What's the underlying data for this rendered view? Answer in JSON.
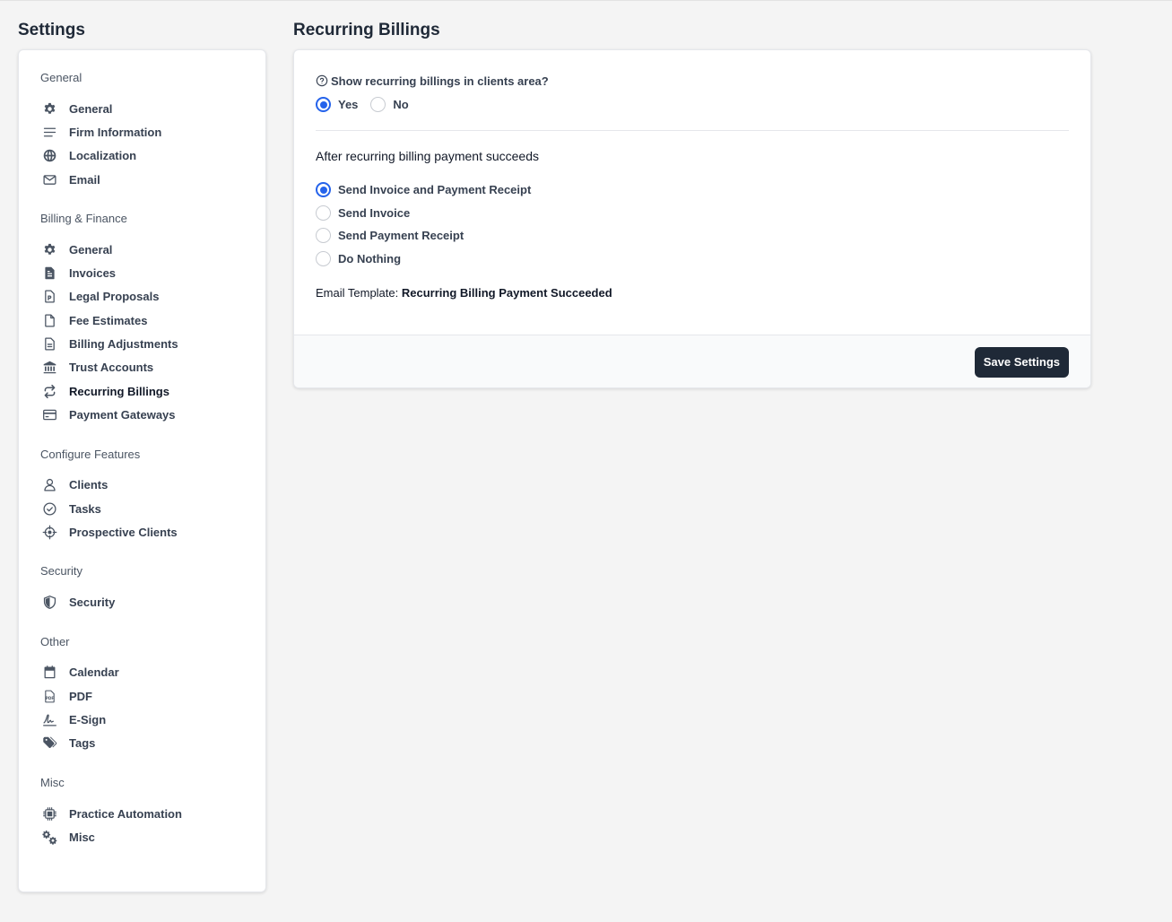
{
  "sidebar": {
    "title": "Settings",
    "sections": [
      {
        "title": "General",
        "items": [
          {
            "label": "General",
            "icon": "gear-icon"
          },
          {
            "label": "Firm Information",
            "icon": "lines-icon"
          },
          {
            "label": "Localization",
            "icon": "globe-icon"
          },
          {
            "label": "Email",
            "icon": "envelope-icon"
          }
        ]
      },
      {
        "title": "Billing & Finance",
        "items": [
          {
            "label": "General",
            "icon": "gear-icon"
          },
          {
            "label": "Invoices",
            "icon": "invoice-icon"
          },
          {
            "label": "Legal Proposals",
            "icon": "proposal-icon"
          },
          {
            "label": "Fee Estimates",
            "icon": "document-icon"
          },
          {
            "label": "Billing Adjustments",
            "icon": "document-lines-icon"
          },
          {
            "label": "Trust Accounts",
            "icon": "bank-icon"
          },
          {
            "label": "Recurring Billings",
            "icon": "repeat-icon",
            "active": true
          },
          {
            "label": "Payment Gateways",
            "icon": "credit-card-icon"
          }
        ]
      },
      {
        "title": "Configure Features",
        "items": [
          {
            "label": "Clients",
            "icon": "user-icon"
          },
          {
            "label": "Tasks",
            "icon": "check-circle-icon"
          },
          {
            "label": "Prospective Clients",
            "icon": "crosshair-icon"
          }
        ]
      },
      {
        "title": "Security",
        "items": [
          {
            "label": "Security",
            "icon": "shield-icon"
          }
        ]
      },
      {
        "title": "Other",
        "items": [
          {
            "label": "Calendar",
            "icon": "calendar-icon"
          },
          {
            "label": "PDF",
            "icon": "pdf-icon"
          },
          {
            "label": "E-Sign",
            "icon": "signature-icon"
          },
          {
            "label": "Tags",
            "icon": "tags-icon"
          }
        ]
      },
      {
        "title": "Misc",
        "items": [
          {
            "label": "Practice Automation",
            "icon": "chip-icon"
          },
          {
            "label": "Misc",
            "icon": "gears-icon"
          }
        ]
      }
    ]
  },
  "main": {
    "title": "Recurring Billings",
    "show_question": "Show recurring billings in clients area?",
    "show_options": [
      {
        "label": "Yes",
        "checked": true
      },
      {
        "label": "No",
        "checked": false
      }
    ],
    "after_heading": "After recurring billing payment succeeds",
    "after_options": [
      {
        "label": "Send Invoice and Payment Receipt",
        "checked": true
      },
      {
        "label": "Send Invoice",
        "checked": false
      },
      {
        "label": "Send Payment Receipt",
        "checked": false
      },
      {
        "label": "Do Nothing",
        "checked": false
      }
    ],
    "template_prefix": "Email Template:",
    "template_name": "Recurring Billing Payment Succeeded",
    "save_label": "Save Settings"
  },
  "colors": {
    "accent": "#2563eb",
    "button_bg": "#1f2937",
    "page_bg": "#f4f4f4"
  }
}
